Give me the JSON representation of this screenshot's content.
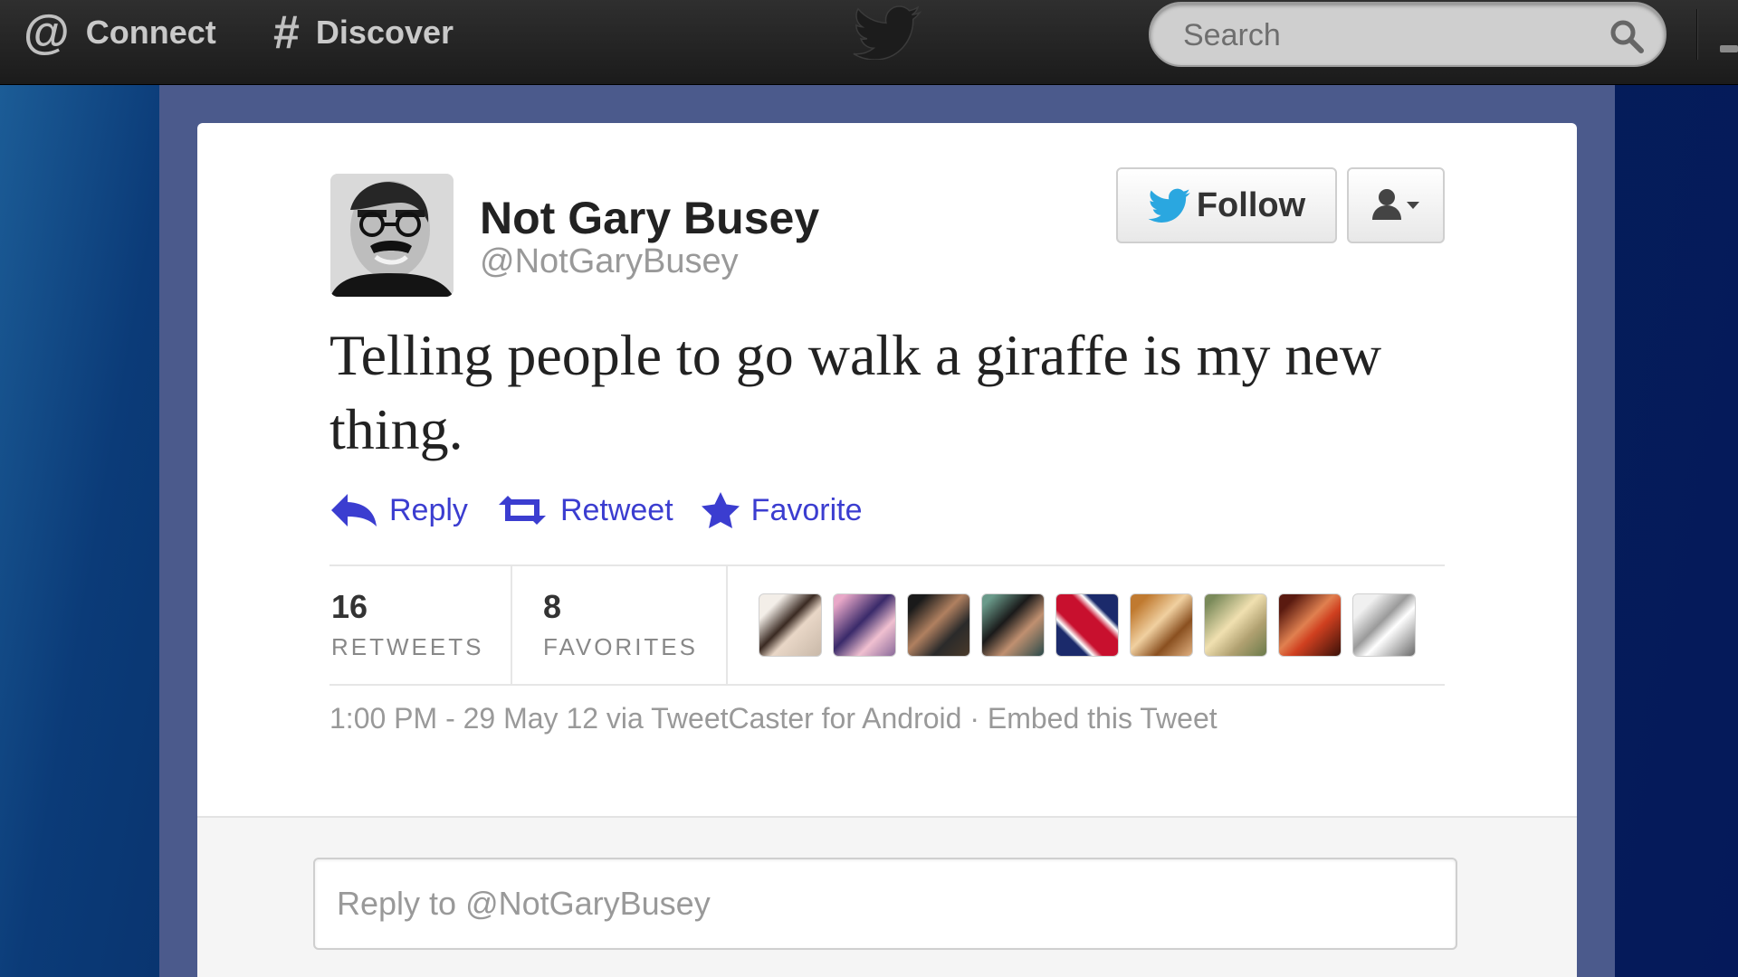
{
  "topbar": {
    "connect_label": "Connect",
    "connect_icon": "@",
    "discover_label": "Discover",
    "discover_icon": "#",
    "search_placeholder": "Search"
  },
  "tweet": {
    "author_name": "Not Gary Busey",
    "author_handle": "@NotGaryBusey",
    "text": "Telling people to go walk a giraffe is my new thing.",
    "follow_label": "Follow",
    "actions": {
      "reply": "Reply",
      "retweet": "Retweet",
      "favorite": "Favorite"
    },
    "stats": {
      "retweets_count": "16",
      "retweets_label": "RETWEETS",
      "favorites_count": "8",
      "favorites_label": "FAVORITES"
    },
    "meta": {
      "timestamp": "1:00 PM - 29 May 12 via TweetCaster for Android",
      "separator": " · ",
      "embed": "Embed this Tweet"
    },
    "reply_placeholder": "Reply to @NotGaryBusey"
  },
  "colors": {
    "link": "#3b3dd0",
    "frame": "#4b5a8c",
    "twitter_blue": "#2aa7e0"
  }
}
